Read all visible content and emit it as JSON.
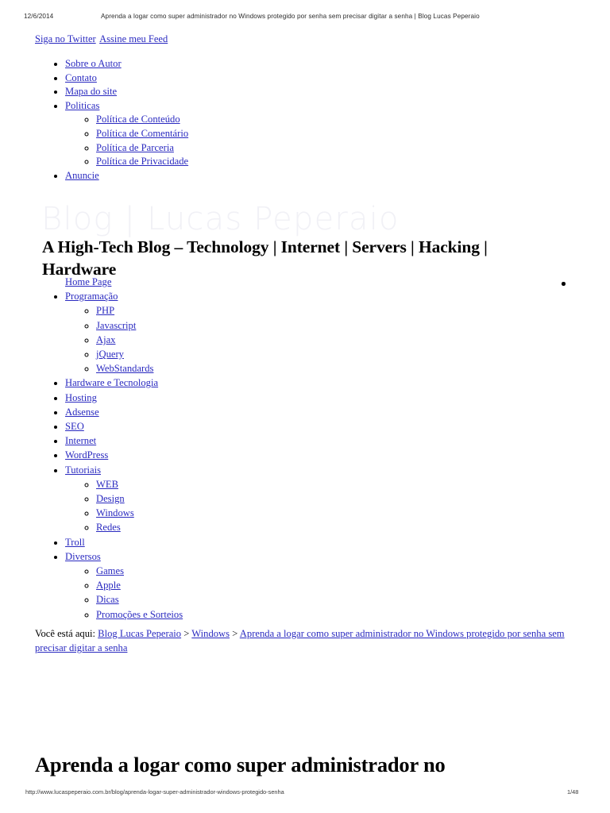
{
  "print_header": {
    "date": "12/6/2014",
    "title": "Aprenda a logar como super administrador no Windows protegido por senha sem precisar digitar a senha | Blog Lucas Peperaio"
  },
  "social": {
    "twitter_label": "Siga no Twitter",
    "feed_label": "Assine meu Feed"
  },
  "utility_nav": {
    "items": [
      {
        "label": "Sobre o Autor"
      },
      {
        "label": "Contato"
      },
      {
        "label": "Mapa do site"
      },
      {
        "label": "Politicas",
        "children": [
          {
            "label": "Política de Conteúdo"
          },
          {
            "label": "Política de Comentário"
          },
          {
            "label": "Política de Parceria"
          },
          {
            "label": "Política de Privacidade"
          }
        ]
      },
      {
        "label": "Anuncie"
      }
    ]
  },
  "branding": {
    "watermark": "Blog | Lucas Peperaio",
    "tagline": "A High-Tech Blog – Technology | Internet | Servers | Hacking | Hardware"
  },
  "main_nav": {
    "items": [
      {
        "label": "Home Page"
      },
      {
        "label": "Programação",
        "children": [
          {
            "label": "PHP"
          },
          {
            "label": "Javascript"
          },
          {
            "label": "Ajax"
          },
          {
            "label": "jQuery"
          },
          {
            "label": "WebStandards"
          }
        ]
      },
      {
        "label": "Hardware e Tecnologia"
      },
      {
        "label": "Hosting"
      },
      {
        "label": "Adsense"
      },
      {
        "label": "SEO"
      },
      {
        "label": "Internet"
      },
      {
        "label": "WordPress"
      },
      {
        "label": "Tutoriais",
        "children": [
          {
            "label": "WEB"
          },
          {
            "label": "Design"
          },
          {
            "label": "Windows"
          },
          {
            "label": "Redes"
          }
        ]
      },
      {
        "label": "Troll"
      },
      {
        "label": "Diversos",
        "children": [
          {
            "label": "Games"
          },
          {
            "label": "Apple"
          },
          {
            "label": "Dicas"
          },
          {
            "label": "Promoções e Sorteios"
          }
        ]
      }
    ]
  },
  "breadcrumb": {
    "prefix": "Você está aqui:",
    "sep1": ">",
    "sep2": ">",
    "item1": "Blog Lucas Peperaio",
    "item2": "Windows",
    "item3": "Aprenda a logar como super administrador no Windows protegido por senha sem precisar digitar a senha"
  },
  "article": {
    "title": "Aprenda a logar como super administrador no"
  },
  "print_footer": {
    "url": "http://www.lucaspeperaio.com.br/blog/aprenda-logar-super-administrador-windows-protegido-senha",
    "page": "1/48"
  },
  "colors": {
    "link": "#2a2ac0",
    "text": "#000000",
    "watermark": "#f1f1f6",
    "page_bg": "#ffffff"
  }
}
